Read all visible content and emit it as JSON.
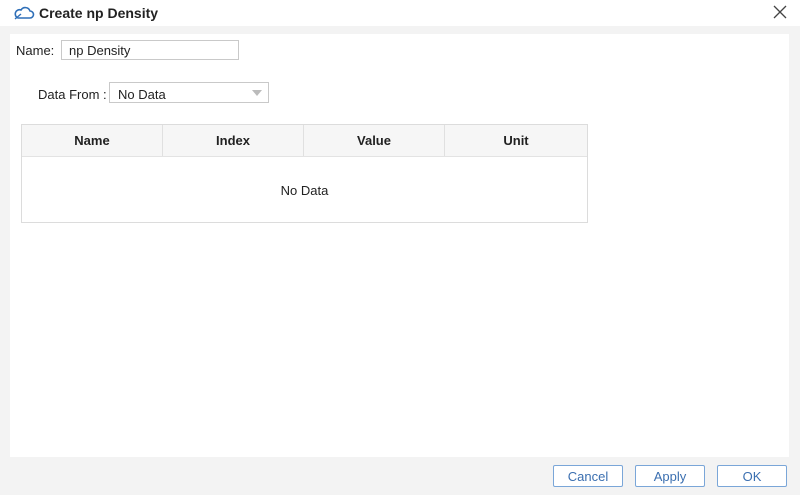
{
  "window": {
    "title": "Create np Density",
    "icon": "cloud-icon",
    "close_icon": "close-icon"
  },
  "form": {
    "name_label": "Name:",
    "name_value": "np Density",
    "data_from_label": "Data From :",
    "data_from_value": "No Data"
  },
  "table": {
    "columns": [
      "Name",
      "Index",
      "Value",
      "Unit"
    ],
    "empty_text": "No Data"
  },
  "buttons": {
    "cancel": "Cancel",
    "apply": "Apply",
    "ok": "OK"
  },
  "colors": {
    "accent": "#3b6fb0",
    "button_border": "#7aa6d8"
  }
}
